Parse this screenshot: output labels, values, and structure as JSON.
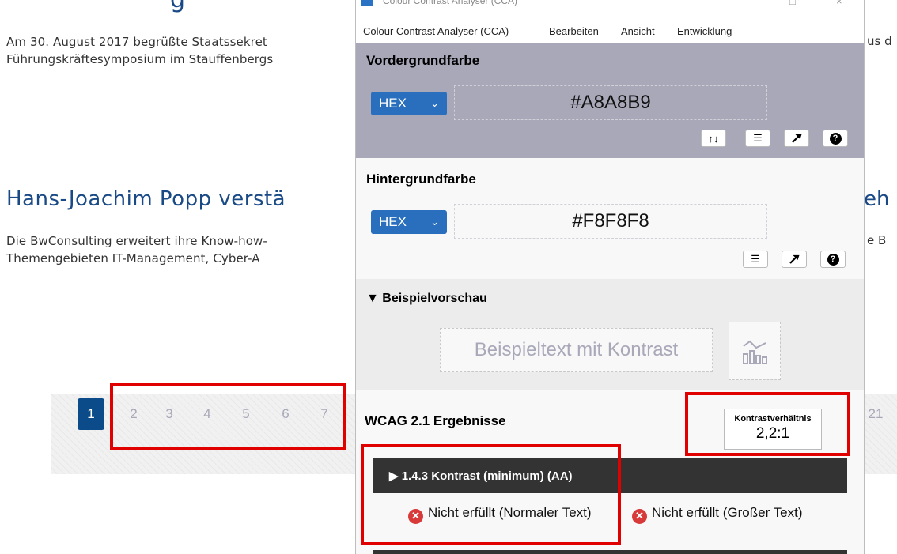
{
  "background_page": {
    "top_heading_fragment": "g",
    "para1_line1": "Am 30. August 2017 begrüßte Staatssekret",
    "para1_line1_right": "us d",
    "para1_line2": "Führungskräftesymposium im Stauffenbergs",
    "heading2": "Hans-Joachim Popp verstä",
    "heading2_right": "eh",
    "para2_line1": "Die BwConsulting erweitert ihre Know-how-",
    "para2_line1_right": "e B",
    "para2_line2": "Themengebieten IT-Management, Cyber-A",
    "pagination": {
      "pages": [
        "1",
        "2",
        "3",
        "4",
        "5",
        "6",
        "7"
      ],
      "active": "1",
      "right_fragment": "21"
    }
  },
  "cca": {
    "title": "Colour Contrast Analyser (CCA)",
    "menu": [
      "Colour Contrast Analyser (CCA)",
      "Bearbeiten",
      "Ansicht",
      "Entwicklung"
    ],
    "foreground": {
      "label": "Vordergrundfarbe",
      "format": "HEX",
      "value": "#A8A8B9",
      "color": "#a8a8b9",
      "tools": [
        "swap-icon",
        "sliders-icon",
        "eyedropper-icon",
        "help-icon"
      ]
    },
    "background": {
      "label": "Hintergrundfarbe",
      "format": "HEX",
      "value": "#F8F8F8",
      "color": "#f8f8f8",
      "tools": [
        "sliders-icon",
        "eyedropper-icon",
        "help-icon"
      ]
    },
    "preview": {
      "header": "▼ Beispielvorschau",
      "sample_text": "Beispieltext mit Kontrast"
    },
    "results": {
      "title": "WCAG 2.1 Ergebnisse",
      "ratio_label": "Kontrastverhältnis",
      "ratio_value": "2,2:1",
      "criterion": "▶ 1.4.3 Kontrast (minimum) (AA)",
      "normal_text_result": "Nicht erfüllt (Normaler Text)",
      "large_text_result": "Nicht erfüllt (Großer Text)"
    }
  },
  "annotation_color": "#e00000"
}
